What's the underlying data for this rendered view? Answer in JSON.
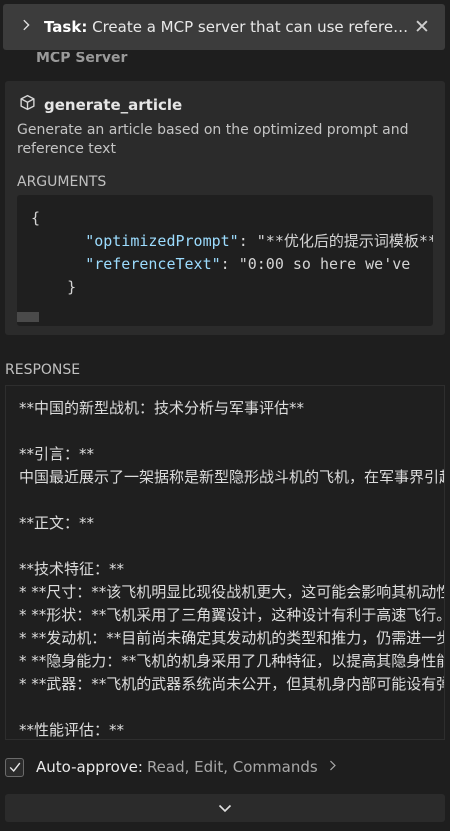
{
  "task": {
    "prefix": "Task:",
    "text": " Create a MCP server that can use reference text and optimized prompt to generate articles",
    "close_glyph": "✕"
  },
  "behind_text": "MCP Server",
  "tool": {
    "name": "generate_article",
    "description": "Generate an article based on the optimized prompt and reference text",
    "arguments_label": "ARGUMENTS",
    "code": {
      "open": "{",
      "key1": "\"optimizedPrompt\"",
      "val1": ": \"**优化后的提示词模板**",
      "key2": "\"referenceText\"",
      "val2": ": \"0:00 so here we've",
      "close": "}"
    }
  },
  "response": {
    "label": "RESPONSE",
    "lines": [
      "**中国的新型战机：技术分析与军事评估**",
      "",
      "**引言：**",
      "中国最近展示了一架据称是新型隐形战斗机的飞机，在军事界引起广泛关注。",
      "",
      "**正文：**",
      "",
      "**技术特征：**",
      "* **尺寸：**该飞机明显比现役战机更大，这可能会影响其机动性和航程。",
      "* **形状：**飞机采用了三角翼设计，这种设计有利于高速飞行。",
      "* **发动机：**目前尚未确定其发动机的类型和推力，仍需进一步观察。",
      "* **隐身能力：**飞机的机身采用了几种特征，以提高其隐身性能。",
      "* **武器：**飞机的武器系统尚未公开，但其机身内部可能设有弹舱。",
      "",
      "**性能评估：**"
    ]
  },
  "auto_approve": {
    "label": "Auto-approve:",
    "values": "Read, Edit, Commands",
    "checked": true
  },
  "colors": {
    "background": "#1e1e1e",
    "card": "#2b2b2b",
    "json_key": "#9cdcfe"
  }
}
